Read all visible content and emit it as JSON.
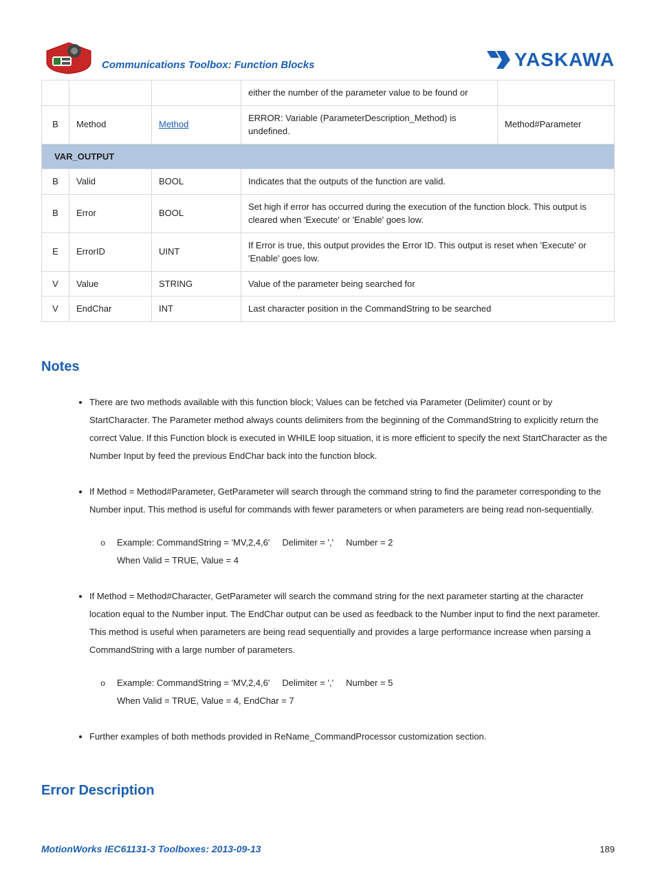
{
  "header": {
    "title": "Communications Toolbox: Function Blocks",
    "brand": "YASKAWA"
  },
  "table": {
    "rows": [
      {
        "a": "",
        "b": "",
        "c": "",
        "d": "either the number of the parameter value to be found or",
        "e": ""
      },
      {
        "a": "B",
        "b": "Method",
        "c_link": "Method",
        "d": "ERROR: Variable (ParameterDescription_Method) is undefined.",
        "e": "Method#Parameter"
      }
    ],
    "section": "VAR_OUTPUT",
    "outputs": [
      {
        "a": "B",
        "b": "Valid",
        "c": "BOOL",
        "d": "Indicates that the outputs of the function are valid."
      },
      {
        "a": "B",
        "b": "Error",
        "c": "BOOL",
        "d": "Set high if error has occurred during the execution of the function block. This output is cleared when 'Execute' or 'Enable' goes low."
      },
      {
        "a": "E",
        "b": "ErrorID",
        "c": "UINT",
        "d": "If Error is true, this output provides the Error ID. This output is reset when 'Execute' or 'Enable' goes low."
      },
      {
        "a": "V",
        "b": "Value",
        "c": "STRING",
        "d": "Value of the parameter being searched for"
      },
      {
        "a": "V",
        "b": "EndChar",
        "c": "INT",
        "d": "Last character position in the CommandString to be searched"
      }
    ]
  },
  "notes": {
    "heading": "Notes",
    "items": [
      {
        "text": "There are two methods available with this function block; Values can be fetched via Parameter (Delimiter) count or by StartCharacter.  The Parameter method always counts delimiters from the beginning of the CommandString to explicitly return the correct Value.  If this Function block is executed in WHILE loop situation, it is more efficient to specify the next StartCharacter as the Number Input by feed the previous EndChar back into the function block."
      },
      {
        "text": "If Method =  Method#Parameter, GetParameter will search through the command string to find the parameter corresponding to the Number input.  This method is useful for commands with fewer parameters or when parameters are being read non-sequentially.",
        "sub": [
          "Example:  CommandString = 'MV,2,4,6'     Delimiter = ','     Number = 2\nWhen Valid = TRUE, Value = 4"
        ]
      },
      {
        "text": "If Method = Method#Character, GetParameter will search the command string for the next parameter starting at the character location equal to the Number input.  The EndChar output can be used as feedback to the Number input to find the next parameter.  This method is useful when parameters are being read sequentially and provides a large performance increase when parsing a CommandString with a large number of parameters.",
        "sub": [
          "Example:  CommandString = 'MV,2,4,6'     Delimiter = ','     Number = 5\nWhen Valid = TRUE, Value = 4, EndChar = 7"
        ]
      },
      {
        "text": "Further examples of both methods provided in ReName_CommandProcessor customization section."
      }
    ]
  },
  "error_heading": "Error Description",
  "footer": {
    "left": "MotionWorks IEC61131-3 Toolboxes: 2013-09-13",
    "page": "189"
  }
}
